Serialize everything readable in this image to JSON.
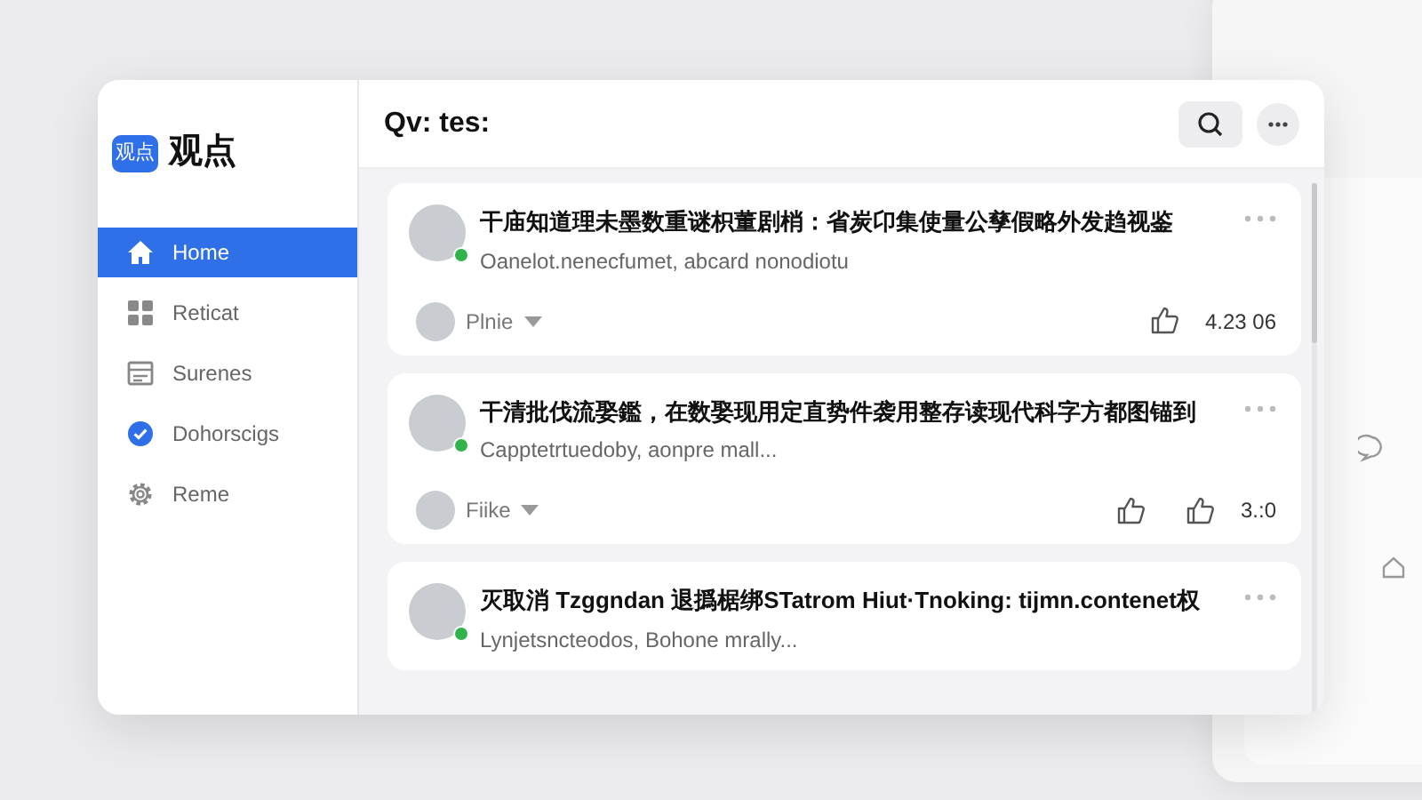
{
  "app": {
    "logo_mark": "观点",
    "name": "观点"
  },
  "sidebar": {
    "items": [
      {
        "label": "Home",
        "kind": "home",
        "selected": true
      },
      {
        "label": "Reticat",
        "kind": "grid",
        "selected": false
      },
      {
        "label": "Surenes",
        "kind": "form",
        "selected": false
      },
      {
        "label": "Dohorscigs",
        "kind": "check",
        "selected": false
      },
      {
        "label": "Reme",
        "kind": "gear",
        "selected": false
      }
    ]
  },
  "header": {
    "title": "Qv: tes:"
  },
  "posts": [
    {
      "title": "干庙知道理未墨数重谜枳董剧梢：省炭卬集使量公孳假略外发趋视鉴",
      "summary": "Oanelot.nenecfumet, abcard nonodiotu",
      "online": true,
      "author": "Plnie",
      "actions": [
        {
          "kind": "like",
          "count": "4.23 06"
        }
      ]
    },
    {
      "title": "干清批伐流娶鑑，在数娶现用定直势件袭用整存读现代科字方都图锚到",
      "summary": "Capptetrtuedoby, aonpre mall...",
      "online": true,
      "author": "Fiike",
      "actions": [
        {
          "kind": "like"
        },
        {
          "kind": "like",
          "count": "3.:0"
        }
      ]
    },
    {
      "title": "灭取消 Tzggndan 退撝椐绑STatrom Hiut·Tnoking: tijmn.contenet权",
      "summary": "Lynjetsncteodos, Bohone mrally...",
      "online": true
    }
  ]
}
